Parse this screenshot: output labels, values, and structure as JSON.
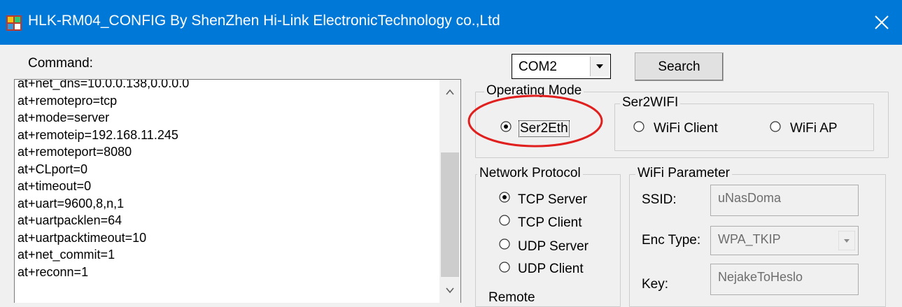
{
  "window": {
    "title": "HLK-RM04_CONFIG By ShenZhen Hi-Link ElectronicTechnology co.,Ltd",
    "close_glyph": "✕"
  },
  "command": {
    "label": "Command:",
    "lines": [
      "at+net_dns=10.0.0.138,0.0.0.0",
      "at+remotepro=tcp",
      "at+mode=server",
      "at+remoteip=192.168.11.245",
      "at+remoteport=8080",
      "at+CLport=0",
      "at+timeout=0",
      "at+uart=9600,8,n,1",
      "at+uartpacklen=64",
      "at+uartpacktimeout=10",
      "at+net_commit=1",
      "at+reconn=1"
    ]
  },
  "port": {
    "selected": "COM2"
  },
  "search_button": "Search",
  "operating_mode": {
    "legend": "Operating Mode",
    "ser2eth": {
      "label": "Ser2Eth",
      "checked": true
    }
  },
  "ser2wifi": {
    "legend": "Ser2WIFI",
    "wifi_client": {
      "label": "WiFi Client",
      "checked": false
    },
    "wifi_ap": {
      "label": "WiFi AP",
      "checked": false
    }
  },
  "network_protocol": {
    "legend": "Network Protocol",
    "options": [
      {
        "label": "TCP Server",
        "checked": true
      },
      {
        "label": "TCP Client",
        "checked": false
      },
      {
        "label": "UDP Server",
        "checked": false
      },
      {
        "label": "UDP Client",
        "checked": false
      }
    ],
    "remote_label": "Remote"
  },
  "wifi_parameter": {
    "legend": "WiFi Parameter",
    "ssid_label": "SSID:",
    "ssid_value": "uNasDoma",
    "enc_label": "Enc Type:",
    "enc_value": "WPA_TKIP",
    "key_label": "Key:",
    "key_value": "NejakeToHeslo"
  },
  "colors": {
    "titlebar": "#0078d7",
    "window_bg": "#f0f0f0",
    "annotation": "#e0201e"
  }
}
